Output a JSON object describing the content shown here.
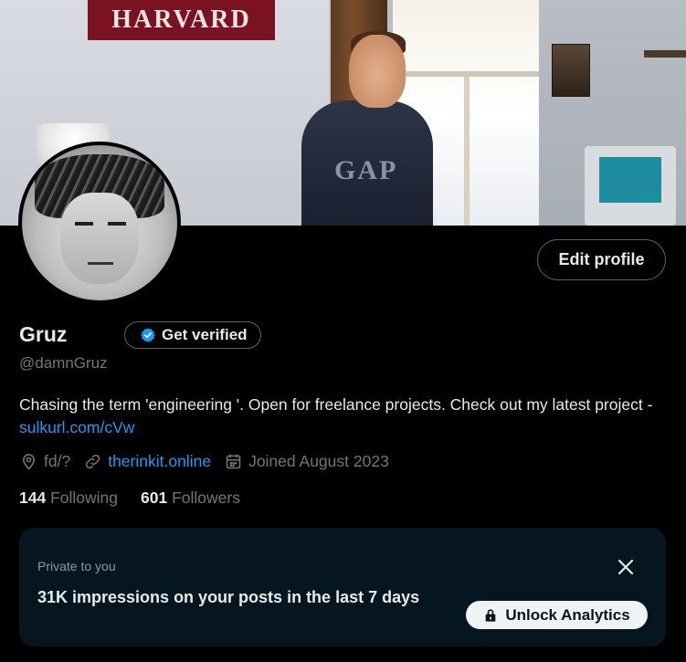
{
  "banner": {
    "pennant_text": "HARVARD",
    "shirt_text": "GAP"
  },
  "profile": {
    "edit_button": "Edit profile",
    "display_name": "Gruz",
    "verify_button": "Get verified",
    "handle": "@damnGruz",
    "bio_text": "Chasing the term 'engineering '. Open for freelance projects. Check out my latest project - ",
    "bio_link": "sulkurl.com/cVw",
    "location": "fd/?",
    "website": "therinkit.online",
    "joined": "Joined August 2023",
    "following_count": "144",
    "following_label": "Following",
    "followers_count": "601",
    "followers_label": "Followers"
  },
  "analytics_card": {
    "private_label": "Private to you",
    "impressions_text": "31K impressions on your posts in the last 7 days",
    "unlock_button": "Unlock Analytics"
  },
  "colors": {
    "background": "#000000",
    "text_primary": "#e7e9ea",
    "text_secondary": "#71767b",
    "link": "#1d9bf0",
    "card_bg": "#061621",
    "verified_badge": "#1d9bf0"
  },
  "icons": {
    "location": "location-pin-icon",
    "website": "link-icon",
    "joined": "calendar-icon",
    "verified": "verified-badge-icon",
    "close": "close-icon",
    "lock": "lock-icon"
  }
}
